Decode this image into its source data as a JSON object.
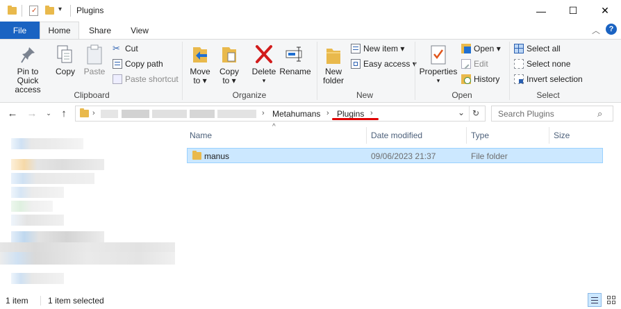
{
  "window": {
    "title": "Plugins",
    "minimize": "—",
    "maximize": "☐",
    "close": "✕"
  },
  "tabs": {
    "file": "File",
    "home": "Home",
    "share": "Share",
    "view": "View"
  },
  "ribbon": {
    "clipboard": {
      "label": "Clipboard",
      "pin": [
        "Pin to Quick",
        "access"
      ],
      "copy": "Copy",
      "paste": "Paste",
      "cut": "Cut",
      "copy_path": "Copy path",
      "paste_shortcut": "Paste shortcut"
    },
    "organize": {
      "label": "Organize",
      "move_to": [
        "Move",
        "to ▾"
      ],
      "copy_to": [
        "Copy",
        "to ▾"
      ],
      "delete": "Delete",
      "rename": "Rename"
    },
    "new": {
      "label": "New",
      "new_folder": [
        "New",
        "folder"
      ],
      "new_item": "New item ▾",
      "easy_access": "Easy access ▾"
    },
    "open": {
      "label": "Open",
      "properties": "Properties",
      "open": "Open ▾",
      "edit": "Edit",
      "history": "History"
    },
    "select": {
      "label": "Select",
      "select_all": "Select all",
      "select_none": "Select none",
      "invert": "Invert selection"
    }
  },
  "address": {
    "crumbs": [
      "Metahumans",
      "Plugins"
    ],
    "search_placeholder": "Search Plugins"
  },
  "columns": {
    "name": "Name",
    "date": "Date modified",
    "type": "Type",
    "size": "Size"
  },
  "files": [
    {
      "name": "manus",
      "date": "09/06/2023 21:37",
      "type": "File folder",
      "size": ""
    }
  ],
  "status": {
    "count": "1 item",
    "selected": "1 item selected"
  },
  "colors": {
    "accent": "#1a63c2",
    "selection": "#cce8ff",
    "folder": "#e9b94c",
    "underline": "#e00000"
  }
}
